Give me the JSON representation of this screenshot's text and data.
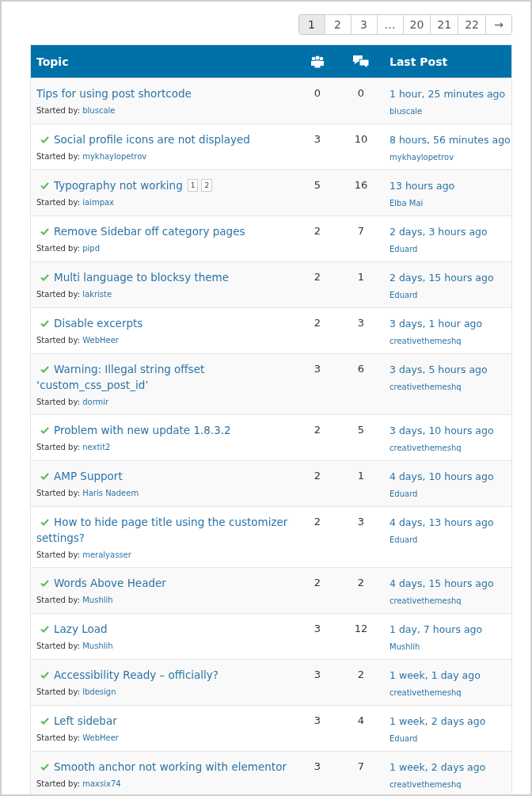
{
  "pagination": [
    {
      "label": "1",
      "selected": true
    },
    {
      "label": "2",
      "selected": false
    },
    {
      "label": "3",
      "selected": false
    },
    {
      "label": "…",
      "selected": false
    },
    {
      "label": "20",
      "selected": false
    },
    {
      "label": "21",
      "selected": false
    },
    {
      "label": "22",
      "selected": false
    },
    {
      "label": "→",
      "selected": false
    }
  ],
  "table": {
    "columns": {
      "topic": "Topic",
      "last_post": "Last Post"
    },
    "rows": [
      {
        "title": "Tips for using post shortcode",
        "resolved": false,
        "started_by_label": "Started by:",
        "author": "bluscale",
        "voices": "0",
        "posts": "0",
        "last_post_time": "1 hour, 25 minutes ago",
        "last_post_author": "bluscale"
      },
      {
        "title": "Social profile icons are not displayed",
        "resolved": true,
        "started_by_label": "Started by:",
        "author": "mykhaylopetrov",
        "voices": "3",
        "posts": "10",
        "last_post_time": "8 hours, 56 minutes ago",
        "last_post_author": "mykhaylopetrov"
      },
      {
        "title": "Typography not working",
        "resolved": true,
        "pages": [
          "1",
          "2"
        ],
        "started_by_label": "Started by:",
        "author": "iaimpax",
        "voices": "5",
        "posts": "16",
        "last_post_time": "13 hours ago",
        "last_post_author": "Elba Mai"
      },
      {
        "title": "Remove Sidebar off category pages",
        "resolved": true,
        "started_by_label": "Started by:",
        "author": "pipd",
        "voices": "2",
        "posts": "7",
        "last_post_time": "2 days, 3 hours ago",
        "last_post_author": "Eduard"
      },
      {
        "title": "Multi language to blocksy theme",
        "resolved": true,
        "started_by_label": "Started by:",
        "author": "lakriste",
        "voices": "2",
        "posts": "1",
        "last_post_time": "2 days, 15 hours ago",
        "last_post_author": "Eduard"
      },
      {
        "title": "Disable excerpts",
        "resolved": true,
        "started_by_label": "Started by:",
        "author": "WebHeer",
        "voices": "2",
        "posts": "3",
        "last_post_time": "3 days, 1 hour ago",
        "last_post_author": "creativethemeshq"
      },
      {
        "title": "Warning: Illegal string offset ‘custom_css_post_id’",
        "resolved": true,
        "started_by_label": "Started by:",
        "author": "dormir",
        "voices": "3",
        "posts": "6",
        "last_post_time": "3 days, 5 hours ago",
        "last_post_author": "creativethemeshq"
      },
      {
        "title": "Problem with new update 1.8.3.2",
        "resolved": true,
        "started_by_label": "Started by:",
        "author": "nextit2",
        "voices": "2",
        "posts": "5",
        "last_post_time": "3 days, 10 hours ago",
        "last_post_author": "creativethemeshq"
      },
      {
        "title": "AMP Support",
        "resolved": true,
        "started_by_label": "Started by:",
        "author": "Haris Nadeem",
        "voices": "2",
        "posts": "1",
        "last_post_time": "4 days, 10 hours ago",
        "last_post_author": "Eduard"
      },
      {
        "title": "How to hide page title using the customizer settings?",
        "resolved": true,
        "started_by_label": "Started by:",
        "author": "meralyasser",
        "voices": "2",
        "posts": "3",
        "last_post_time": "4 days, 13 hours ago",
        "last_post_author": "Eduard"
      },
      {
        "title": "Words Above Header",
        "resolved": true,
        "started_by_label": "Started by:",
        "author": "Mushlih",
        "voices": "2",
        "posts": "2",
        "last_post_time": "4 days, 15 hours ago",
        "last_post_author": "creativethemeshq"
      },
      {
        "title": "Lazy Load",
        "resolved": true,
        "started_by_label": "Started by:",
        "author": "Mushlih",
        "voices": "3",
        "posts": "12",
        "last_post_time": "1 day, 7 hours ago",
        "last_post_author": "Mushlih"
      },
      {
        "title": "Accessibility Ready – officially?",
        "resolved": true,
        "started_by_label": "Started by:",
        "author": "lbdesign",
        "voices": "3",
        "posts": "2",
        "last_post_time": "1 week, 1 day ago",
        "last_post_author": "creativethemeshq"
      },
      {
        "title": "Left sidebar",
        "resolved": true,
        "started_by_label": "Started by:",
        "author": "WebHeer",
        "voices": "3",
        "posts": "4",
        "last_post_time": "1 week, 2 days ago",
        "last_post_author": "Eduard"
      },
      {
        "title": "Smooth anchor not working with elementor",
        "resolved": true,
        "started_by_label": "Started by:",
        "author": "maxsix74",
        "voices": "3",
        "posts": "7",
        "last_post_time": "1 week, 2 days ago",
        "last_post_author": "creativethemeshq"
      }
    ]
  }
}
